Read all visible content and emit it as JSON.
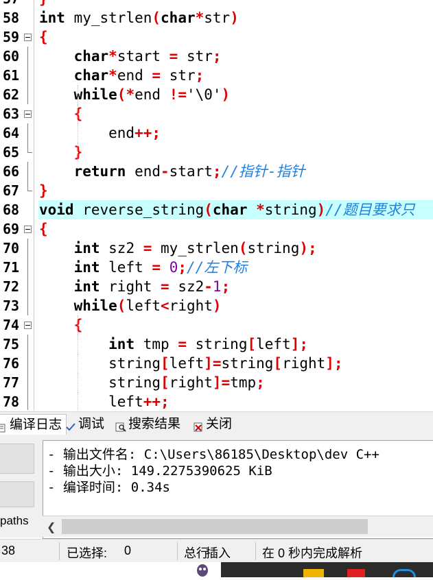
{
  "editor": {
    "lines": [
      {
        "num": "57",
        "fold": "none",
        "tokens": [
          {
            "t": "}",
            "c": "p"
          }
        ]
      },
      {
        "num": "58",
        "fold": "none",
        "tokens": [
          {
            "t": "int",
            "c": "k"
          },
          {
            "t": " my_strlen",
            "c": "s"
          },
          {
            "t": "(",
            "c": "p"
          },
          {
            "t": "char",
            "c": "k"
          },
          {
            "t": "*",
            "c": "p"
          },
          {
            "t": "str",
            "c": "s"
          },
          {
            "t": ")",
            "c": "p"
          }
        ]
      },
      {
        "num": "59",
        "fold": "open",
        "tokens": [
          {
            "t": "{",
            "c": "p"
          }
        ]
      },
      {
        "num": "60",
        "fold": "line",
        "tokens": [
          {
            "t": "    ",
            "c": "s"
          },
          {
            "t": "char",
            "c": "k"
          },
          {
            "t": "*",
            "c": "p"
          },
          {
            "t": "start ",
            "c": "s"
          },
          {
            "t": "=",
            "c": "p"
          },
          {
            "t": " str",
            "c": "s"
          },
          {
            "t": ";",
            "c": "p"
          }
        ]
      },
      {
        "num": "61",
        "fold": "line",
        "tokens": [
          {
            "t": "    ",
            "c": "s"
          },
          {
            "t": "char",
            "c": "k"
          },
          {
            "t": "*",
            "c": "p"
          },
          {
            "t": "end ",
            "c": "s"
          },
          {
            "t": "=",
            "c": "p"
          },
          {
            "t": " str",
            "c": "s"
          },
          {
            "t": ";",
            "c": "p"
          }
        ]
      },
      {
        "num": "62",
        "fold": "line",
        "tokens": [
          {
            "t": "    ",
            "c": "s"
          },
          {
            "t": "while",
            "c": "k"
          },
          {
            "t": "(*",
            "c": "p"
          },
          {
            "t": "end ",
            "c": "s"
          },
          {
            "t": "!=",
            "c": "p"
          },
          {
            "t": "'\\0'",
            "c": "s"
          },
          {
            "t": ")",
            "c": "p"
          }
        ]
      },
      {
        "num": "63",
        "fold": "open",
        "tokens": [
          {
            "t": "    ",
            "c": "s"
          },
          {
            "t": "{",
            "c": "p"
          }
        ]
      },
      {
        "num": "64",
        "fold": "line",
        "tokens": [
          {
            "t": "        end",
            "c": "s"
          },
          {
            "t": "++;",
            "c": "p"
          }
        ]
      },
      {
        "num": "65",
        "fold": "end",
        "tokens": [
          {
            "t": "    ",
            "c": "s"
          },
          {
            "t": "}",
            "c": "p"
          }
        ]
      },
      {
        "num": "66",
        "fold": "line",
        "tokens": [
          {
            "t": "    ",
            "c": "s"
          },
          {
            "t": "return",
            "c": "k"
          },
          {
            "t": " end",
            "c": "s"
          },
          {
            "t": "-",
            "c": "p"
          },
          {
            "t": "start",
            "c": "s"
          },
          {
            "t": ";",
            "c": "p"
          },
          {
            "t": "//指针-指针",
            "c": "c"
          }
        ]
      },
      {
        "num": "67",
        "fold": "end",
        "tokens": [
          {
            "t": "}",
            "c": "p"
          }
        ]
      },
      {
        "num": "68",
        "fold": "none",
        "hl": true,
        "tokens": [
          {
            "t": "void",
            "c": "k"
          },
          {
            "t": " reverse_string",
            "c": "s"
          },
          {
            "t": "(",
            "c": "p"
          },
          {
            "t": "char",
            "c": "k"
          },
          {
            "t": " *",
            "c": "p"
          },
          {
            "t": "string",
            "c": "s"
          },
          {
            "t": ")",
            "c": "p"
          },
          {
            "t": "//题目要求只",
            "c": "c"
          }
        ]
      },
      {
        "num": "69",
        "fold": "open",
        "tokens": [
          {
            "t": "{",
            "c": "p"
          }
        ]
      },
      {
        "num": "70",
        "fold": "line",
        "tokens": [
          {
            "t": "    ",
            "c": "s"
          },
          {
            "t": "int",
            "c": "k"
          },
          {
            "t": " sz2 ",
            "c": "s"
          },
          {
            "t": "=",
            "c": "p"
          },
          {
            "t": " my_strlen",
            "c": "s"
          },
          {
            "t": "(",
            "c": "p"
          },
          {
            "t": "string",
            "c": "s"
          },
          {
            "t": ");",
            "c": "p"
          }
        ]
      },
      {
        "num": "71",
        "fold": "line",
        "tokens": [
          {
            "t": "    ",
            "c": "s"
          },
          {
            "t": "int",
            "c": "k"
          },
          {
            "t": " left ",
            "c": "s"
          },
          {
            "t": "=",
            "c": "p"
          },
          {
            "t": " ",
            "c": "s"
          },
          {
            "t": "0",
            "c": "n"
          },
          {
            "t": ";",
            "c": "p"
          },
          {
            "t": "//左下标",
            "c": "c"
          }
        ]
      },
      {
        "num": "72",
        "fold": "line",
        "tokens": [
          {
            "t": "    ",
            "c": "s"
          },
          {
            "t": "int",
            "c": "k"
          },
          {
            "t": " right ",
            "c": "s"
          },
          {
            "t": "=",
            "c": "p"
          },
          {
            "t": " sz2",
            "c": "s"
          },
          {
            "t": "-",
            "c": "p"
          },
          {
            "t": "1",
            "c": "n"
          },
          {
            "t": ";",
            "c": "p"
          }
        ]
      },
      {
        "num": "73",
        "fold": "line",
        "tokens": [
          {
            "t": "    ",
            "c": "s"
          },
          {
            "t": "while",
            "c": "k"
          },
          {
            "t": "(",
            "c": "p"
          },
          {
            "t": "left",
            "c": "s"
          },
          {
            "t": "<",
            "c": "p"
          },
          {
            "t": "right",
            "c": "s"
          },
          {
            "t": ")",
            "c": "p"
          }
        ]
      },
      {
        "num": "74",
        "fold": "open",
        "tokens": [
          {
            "t": "    ",
            "c": "s"
          },
          {
            "t": "{",
            "c": "p"
          }
        ]
      },
      {
        "num": "75",
        "fold": "line",
        "tokens": [
          {
            "t": "        ",
            "c": "s"
          },
          {
            "t": "int",
            "c": "k"
          },
          {
            "t": " tmp ",
            "c": "s"
          },
          {
            "t": "=",
            "c": "p"
          },
          {
            "t": " string",
            "c": "s"
          },
          {
            "t": "[",
            "c": "p"
          },
          {
            "t": "left",
            "c": "s"
          },
          {
            "t": "];",
            "c": "p"
          }
        ]
      },
      {
        "num": "76",
        "fold": "line",
        "tokens": [
          {
            "t": "        string",
            "c": "s"
          },
          {
            "t": "[",
            "c": "p"
          },
          {
            "t": "left",
            "c": "s"
          },
          {
            "t": "]=",
            "c": "p"
          },
          {
            "t": "string",
            "c": "s"
          },
          {
            "t": "[",
            "c": "p"
          },
          {
            "t": "right",
            "c": "s"
          },
          {
            "t": "];",
            "c": "p"
          }
        ]
      },
      {
        "num": "77",
        "fold": "line",
        "tokens": [
          {
            "t": "        string",
            "c": "s"
          },
          {
            "t": "[",
            "c": "p"
          },
          {
            "t": "right",
            "c": "s"
          },
          {
            "t": "]=",
            "c": "p"
          },
          {
            "t": "tmp",
            "c": "s"
          },
          {
            "t": ";",
            "c": "p"
          }
        ]
      },
      {
        "num": "78",
        "fold": "line",
        "tokens": [
          {
            "t": "        left",
            "c": "s"
          },
          {
            "t": "++;",
            "c": "p"
          }
        ]
      }
    ]
  },
  "tabs": [
    {
      "label": "编译日志",
      "icon": "compile-log-icon",
      "active": true
    },
    {
      "label": "调试",
      "icon": "debug-check-icon",
      "active": false
    },
    {
      "label": "搜索结果",
      "icon": "search-results-icon",
      "active": false
    },
    {
      "label": "关闭",
      "icon": "close-panel-icon",
      "active": false
    }
  ],
  "panel": {
    "paths_label": "paths",
    "log_lines": [
      "- 输出文件名: C:\\Users\\86185\\Desktop\\dev C++",
      "- 输出大小: 149.2275390625 KiB",
      "- 编译时间: 0.34s"
    ]
  },
  "status": {
    "line_value": "38",
    "selected_label": "已选择:",
    "selected_value": "0",
    "total_label": "总行",
    "insert_mode": "插入",
    "parse_msg": "在 0 秒内完成解析"
  },
  "colors": {
    "keyword": "#000000",
    "operator": "#e00000",
    "number": "#8000a0",
    "comment": "#2080e0",
    "highlight": "#c8ffff"
  }
}
